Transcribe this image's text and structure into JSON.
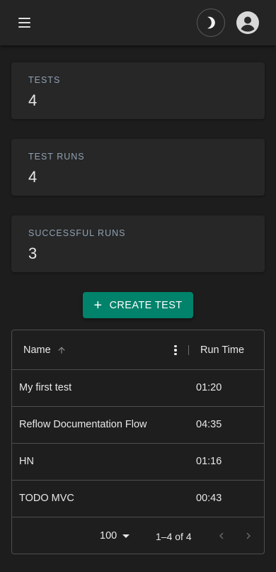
{
  "header": {
    "menu_icon": "hamburger-menu-icon",
    "theme_icon": "moon-icon",
    "account_icon": "account-circle-icon"
  },
  "stats": [
    {
      "label": "TESTS",
      "value": "4"
    },
    {
      "label": "TEST RUNS",
      "value": "4"
    },
    {
      "label": "SUCCESSFUL RUNS",
      "value": "3"
    }
  ],
  "create_button": {
    "label": "CREATE TEST",
    "icon": "plus-icon"
  },
  "table": {
    "columns": {
      "name": "Name",
      "run_time": "Run Time"
    },
    "sort": {
      "column": "Name",
      "direction": "ascending"
    },
    "rows": [
      {
        "name": "My first test",
        "run_time": "01:20"
      },
      {
        "name": "Reflow Documentation Flow",
        "run_time": "04:35"
      },
      {
        "name": "HN",
        "run_time": "01:16"
      },
      {
        "name": "TODO MVC",
        "run_time": "00:43"
      }
    ],
    "pagination": {
      "page_size": "100",
      "range": "1–4 of 4"
    }
  },
  "colors": {
    "accent": "#00826b",
    "background": "#1d1d1d",
    "card": "#272727",
    "stat_label": "#8fa2b3"
  }
}
